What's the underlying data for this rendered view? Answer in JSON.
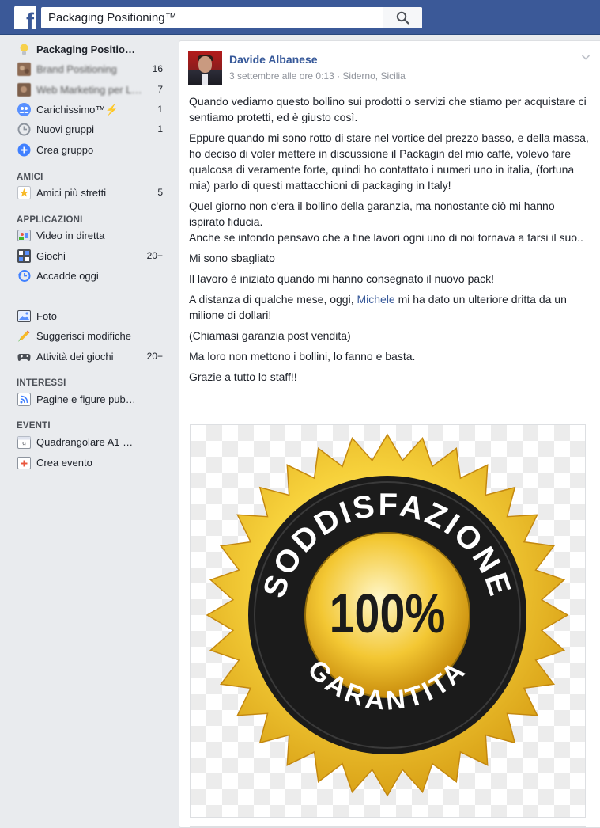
{
  "topbar": {
    "logo": "f",
    "search_value": "Packaging Positioning™",
    "search_icon": "search-icon"
  },
  "leftnav": {
    "items": [
      {
        "label": "Packaging Positio…",
        "count": "",
        "icon": "lightbulb-icon"
      },
      {
        "label": "Brand Positioning",
        "count": "16",
        "icon": "group-thumbnail-icon"
      },
      {
        "label": "Web Marketing per L…",
        "count": "7",
        "icon": "group-thumbnail-icon"
      },
      {
        "label": "Carichissimo™⚡",
        "count": "1",
        "icon": "group-people-icon"
      },
      {
        "label": "Nuovi gruppi",
        "count": "1",
        "icon": "clock-icon"
      },
      {
        "label": "Crea gruppo",
        "count": "",
        "icon": "plus-circle-icon"
      }
    ],
    "amici_heading": "AMICI",
    "amici": [
      {
        "label": "Amici più stretti",
        "count": "5",
        "icon": "star-icon"
      }
    ],
    "applicazioni_heading": "APPLICAZIONI",
    "applicazioni": [
      {
        "label": "Video in diretta",
        "count": "",
        "icon": "live-video-icon"
      },
      {
        "label": "Giochi",
        "count": "20+",
        "icon": "games-icon"
      },
      {
        "label": "Accadde oggi",
        "count": "",
        "icon": "history-icon"
      },
      {
        "label": "Foto",
        "count": "",
        "icon": "photo-icon"
      },
      {
        "label": "Suggerisci modifiche",
        "count": "",
        "icon": "pencil-icon"
      },
      {
        "label": "Attività dei giochi",
        "count": "20+",
        "icon": "gamepad-icon"
      }
    ],
    "interessi_heading": "INTERESSI",
    "interessi": [
      {
        "label": "Pagine e figure pub…",
        "count": "",
        "icon": "rss-icon"
      }
    ],
    "eventi_heading": "EVENTI",
    "eventi": [
      {
        "label": "Quadrangolare A1 …",
        "count": "",
        "icon": "calendar-icon"
      },
      {
        "label": "Crea evento",
        "count": "",
        "icon": "calendar-add-icon"
      }
    ]
  },
  "post": {
    "author": "Davide Albanese",
    "meta": "3 settembre alle ore 0:13 · Siderno, Sicilia",
    "paragraphs": [
      "Quando vediamo questo bollino sui prodotti o servizi che stiamo per acquistare ci sentiamo protetti, ed è giusto così.",
      "Eppure quando mi sono rotto di stare nel vortice del prezzo basso, e della massa, ho deciso di voler mettere in discussione il Packagin del mio caffè, volevo fare qualcosa di veramente forte, quindi ho contattato i numeri uno in italia, (fortuna mia) parlo di questi mattacchioni di packaging in Italy!",
      "Quel giorno non c'era il bollino della garanzia, ma nonostante ciò mi hanno ispirato fiducia.",
      "Anche se infondo pensavo che a fine lavori ogni uno di noi tornava a farsi il suo..",
      "Mi sono sbagliato",
      "Il lavoro è iniziato quando mi hanno consegnato il nuovo pack!"
    ],
    "mention_before": "A distanza di qualche mese, oggi, ",
    "mention": "Michele",
    "mention_after": " mi ha dato un ulteriore dritta da un milione di dollari!",
    "paragraphs_end": [
      "(Chiamasi garanzia post vendita)",
      "Ma loro non mettono i bollini, lo fanno e basta.",
      "Grazie a tutto lo staff!!"
    ],
    "badge": {
      "top_text": "SODDISFAZIONE",
      "center_text": "100%",
      "bottom_text": "GARANTITA",
      "gold": "#f2c21c",
      "ring": "#1a1a1a"
    }
  }
}
